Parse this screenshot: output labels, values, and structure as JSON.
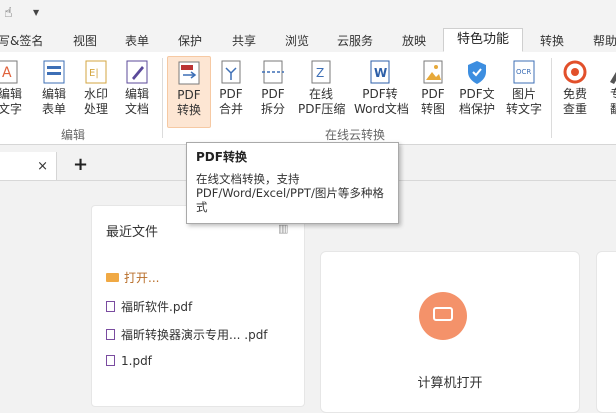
{
  "quick_access": {
    "hand_icon": "hand-pointer-icon",
    "dropdown_icon": "dropdown-arrow-icon"
  },
  "tabs": [
    "写&签名",
    "视图",
    "表单",
    "保护",
    "共享",
    "浏览",
    "云服务",
    "放映",
    "特色功能",
    "转换",
    "帮助"
  ],
  "active_tab": "特色功能",
  "ribbon": {
    "buttons": [
      {
        "name": "edit-text",
        "label": "编辑\n文字"
      },
      {
        "name": "edit-form",
        "label": "编辑\n表单"
      },
      {
        "name": "watermark",
        "label": "水印\n处理"
      },
      {
        "name": "edit-document",
        "label": "编辑\n文档"
      },
      {
        "name": "pdf-convert",
        "label": "PDF\n转换"
      },
      {
        "name": "pdf-merge",
        "label": "PDF\n合并"
      },
      {
        "name": "pdf-split",
        "label": "PDF\n拆分"
      },
      {
        "name": "online-compress",
        "label": "在线\nPDF压缩"
      },
      {
        "name": "pdf-to-word",
        "label": "PDF转\nWord文档"
      },
      {
        "name": "pdf-to-image",
        "label": "PDF\n转图"
      },
      {
        "name": "pdf-protect",
        "label": "PDF文\n档保护"
      },
      {
        "name": "image-to-text",
        "label": "图片\n转文字"
      },
      {
        "name": "free-check",
        "label": "免费\n查重"
      },
      {
        "name": "professional",
        "label": "专\n翻"
      }
    ],
    "groups": {
      "edit": "编辑",
      "online_convert": "在线云转换"
    }
  },
  "tooltip": {
    "title": "PDF转换",
    "desc": "在线文档转换，支持PDF/Word/Excel/PPT/图片等多种格式"
  },
  "doc_tabs": {
    "close": "×",
    "add": "+"
  },
  "recent": {
    "title": "最近文件",
    "open_label": "打开...",
    "files": [
      "福昕软件.pdf",
      "福昕转换器演示专用...  .pdf",
      "1.pdf"
    ]
  },
  "card": {
    "caption": "计算机打开"
  },
  "colors": {
    "accent": "#f4926a",
    "selected_bg": "#fde6d3"
  }
}
